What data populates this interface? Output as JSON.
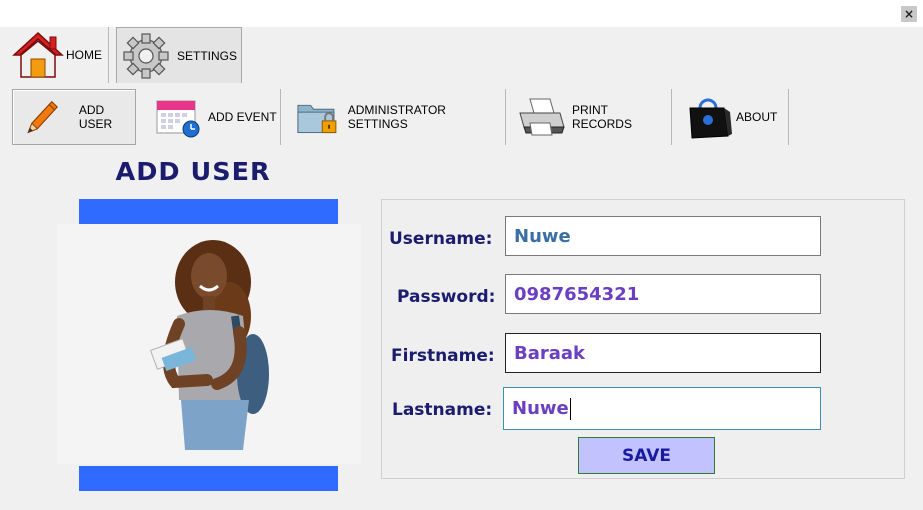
{
  "window": {
    "close_glyph": "×"
  },
  "tabs": [
    {
      "label": "HOME",
      "icon": "house-icon"
    },
    {
      "label": "SETTINGS",
      "icon": "gear-icon",
      "selected": true
    }
  ],
  "settings_menu": [
    {
      "label": "ADD USER",
      "icon": "pencil-icon",
      "selected": true
    },
    {
      "label": "ADD EVENT",
      "icon": "calendar-icon"
    },
    {
      "label": "ADMINISTRATOR SETTINGS",
      "icon": "locked-folder-icon"
    },
    {
      "label": "PRINT RECORDS",
      "icon": "printer-icon"
    },
    {
      "label": "ABOUT",
      "icon": "shopping-bag-icon"
    }
  ],
  "page": {
    "title": "ADD USER"
  },
  "form": {
    "fields": [
      {
        "label": "Username:",
        "value": "Nuwe",
        "color": "#3a6ea5"
      },
      {
        "label": "Password:",
        "value": "0987654321",
        "color": "#6a3fc1"
      },
      {
        "label": "Firstname:",
        "value": "Baraak",
        "color": "#6a3fc1"
      },
      {
        "label": "Lastname:",
        "value": "Nuwe",
        "color": "#6a3fc1"
      }
    ],
    "save_label": "SAVE"
  },
  "colors": {
    "accent_bar": "#2f6bff",
    "label_text": "#1c1c6e",
    "save_button_bg": "#c2c2ff",
    "save_button_text": "#1a1aa0"
  }
}
